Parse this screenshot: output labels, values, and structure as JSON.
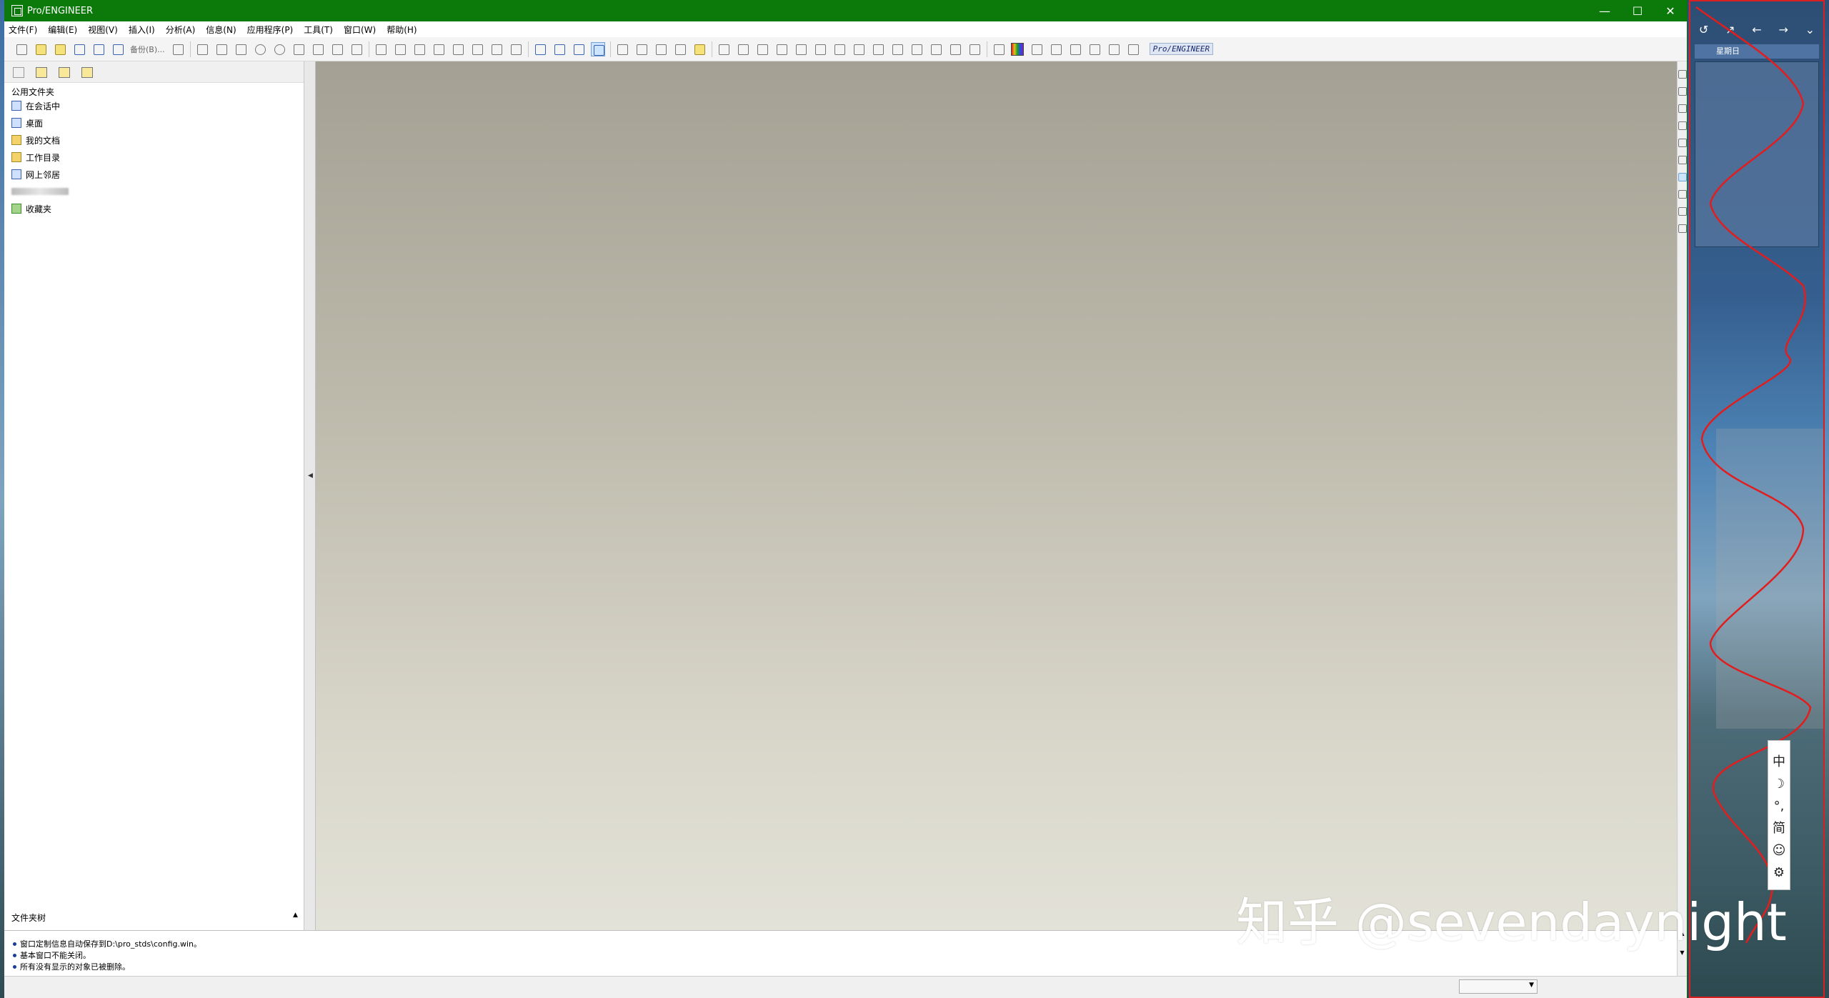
{
  "window": {
    "title": "Pro/ENGINEER",
    "controls": [
      "—",
      "☐",
      "✕"
    ]
  },
  "menu": [
    "文件(F)",
    "编辑(E)",
    "视图(V)",
    "插入(I)",
    "分析(A)",
    "信息(N)",
    "应用程序(P)",
    "工具(T)",
    "窗口(W)",
    "帮助(H)"
  ],
  "toolbar": {
    "backup_label": "备份(B)...",
    "proe_label": "Pro/ENGINEER"
  },
  "navigator": {
    "header": "公用文件夹",
    "items": [
      {
        "label": "在会话中",
        "icon": "session-icon"
      },
      {
        "label": "桌面",
        "icon": "desktop-icon"
      },
      {
        "label": "我的文档",
        "icon": "documents-icon"
      },
      {
        "label": "工作目录",
        "icon": "working-dir-icon"
      },
      {
        "label": "网上邻居",
        "icon": "network-icon"
      },
      {
        "label": "",
        "icon": "blurred-item-icon"
      },
      {
        "label": "收藏夹",
        "icon": "favorites-icon"
      }
    ],
    "footer": "文件夹树"
  },
  "messages": [
    "窗口定制信息自动保存到D:\\pro_stds\\config.win。",
    "基本窗口不能关闭。",
    "所有没有显示的对象已被删除。"
  ],
  "side_widget": {
    "day": "星期日",
    "nav_icons": [
      "↺",
      "↗",
      "←",
      "→",
      "⌄"
    ]
  },
  "ime": [
    "中",
    "☽",
    "°,",
    "简",
    "☺",
    "⚙"
  ],
  "watermark": "知乎 @sevendaynight"
}
